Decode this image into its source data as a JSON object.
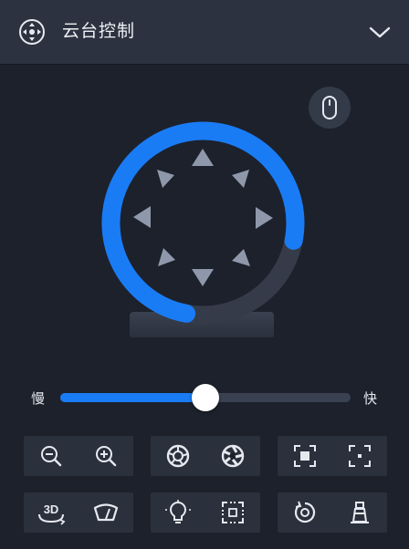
{
  "header": {
    "title": "云台控制",
    "icon": "ptz-direction-icon",
    "collapse_icon": "chevron-down-icon"
  },
  "mouse_mode": {
    "icon": "mouse-icon"
  },
  "dial": {
    "directions": [
      "up",
      "up-right",
      "right",
      "down-right",
      "down",
      "down-left",
      "left",
      "up-left"
    ],
    "arc_color": "#1a7cf5",
    "track_color": "#3a4150",
    "arrow_color": "#8f98ab"
  },
  "speed": {
    "slow_label": "慢",
    "fast_label": "快",
    "value": 0.5,
    "fill_color": "#1a7cf5"
  },
  "tool_groups": [
    {
      "name": "zoom",
      "buttons": [
        {
          "icon": "zoom-out-icon"
        },
        {
          "icon": "zoom-in-icon"
        }
      ]
    },
    {
      "name": "iris",
      "buttons": [
        {
          "icon": "iris-close-icon"
        },
        {
          "icon": "iris-open-icon"
        }
      ]
    },
    {
      "name": "focus",
      "buttons": [
        {
          "icon": "focus-near-icon"
        },
        {
          "icon": "focus-far-icon"
        }
      ]
    },
    {
      "name": "view",
      "buttons": [
        {
          "icon": "3d-rotate-icon",
          "label": "3D"
        },
        {
          "icon": "wiper-icon"
        }
      ]
    },
    {
      "name": "light",
      "buttons": [
        {
          "icon": "light-icon"
        },
        {
          "icon": "auto-focus-frame-icon"
        }
      ]
    },
    {
      "name": "misc",
      "buttons": [
        {
          "icon": "reset-rotate-icon"
        },
        {
          "icon": "lighthouse-icon"
        }
      ]
    }
  ]
}
